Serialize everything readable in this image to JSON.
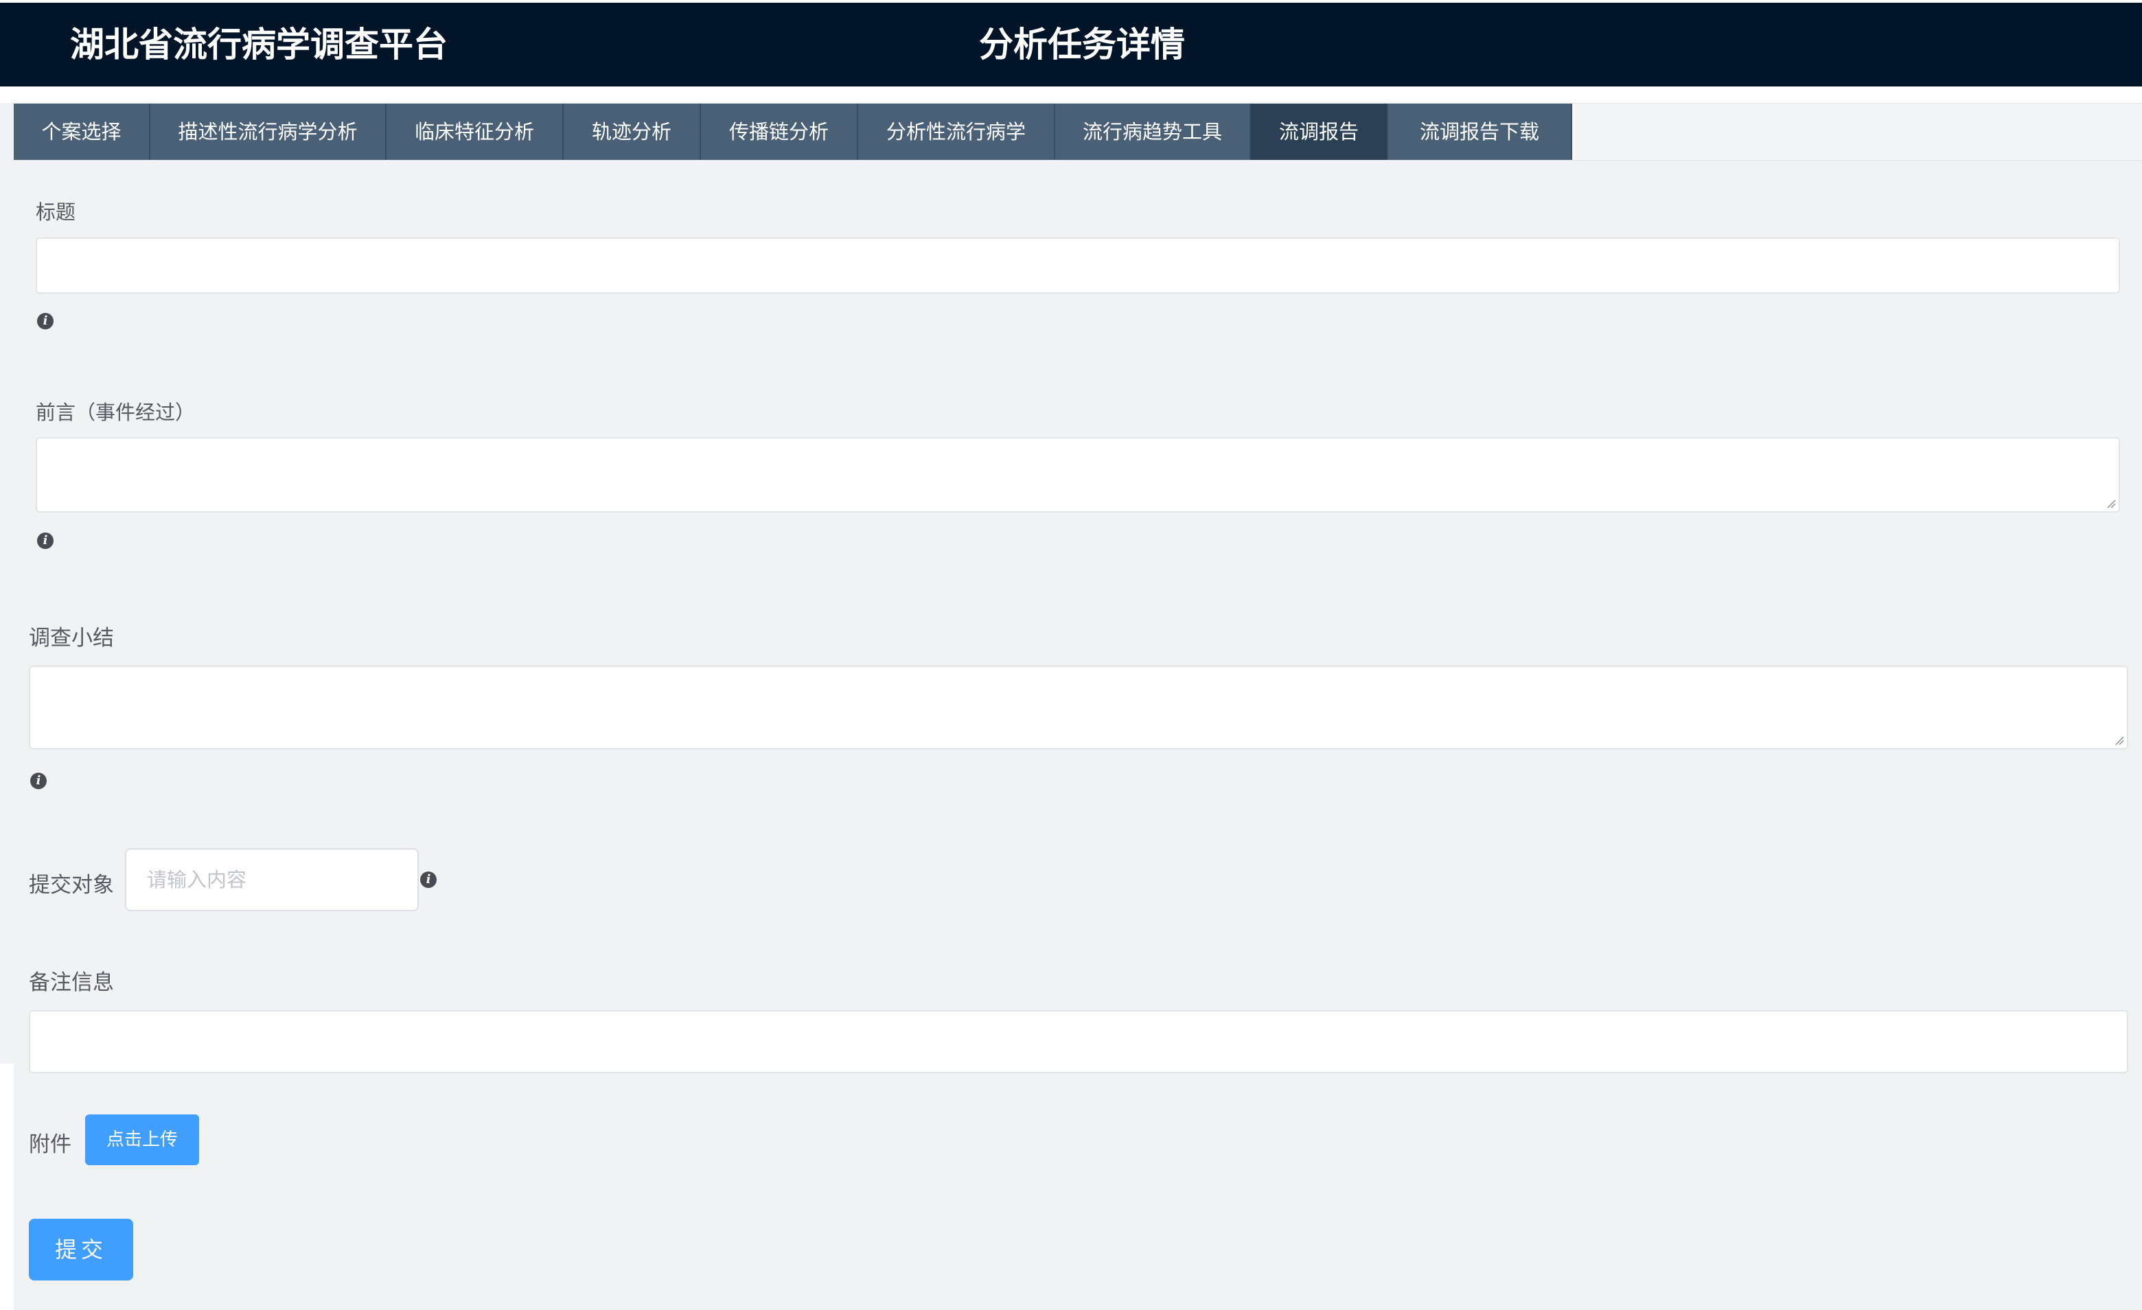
{
  "header": {
    "app_title": "湖北省流行病学调查平台",
    "page_title": "分析任务详情"
  },
  "tabs": [
    {
      "label": "个案选择",
      "active": false
    },
    {
      "label": "描述性流行病学分析",
      "active": false
    },
    {
      "label": "临床特征分析",
      "active": false
    },
    {
      "label": "轨迹分析",
      "active": false
    },
    {
      "label": "传播链分析",
      "active": false
    },
    {
      "label": "分析性流行病学",
      "active": false
    },
    {
      "label": "流行病趋势工具",
      "active": false
    },
    {
      "label": "流调报告",
      "active": true
    },
    {
      "label": "流调报告下载",
      "active": false
    }
  ],
  "form": {
    "title_label": "标题",
    "title_value": "",
    "preface_label": "前言（事件经过）",
    "preface_value": "",
    "summary_label": "调查小结",
    "summary_value": "",
    "target_label": "提交对象",
    "target_placeholder": "请输入内容",
    "remark_label": "备注信息",
    "remark_value": "",
    "attachment_label": "附件",
    "upload_button": "点击上传",
    "submit_button": "提交"
  },
  "icons": {
    "info": "info-icon"
  },
  "colors": {
    "header_bg": "#021428",
    "tab_bg": "#4a6077",
    "tab_active_bg": "#2b3f55",
    "primary_button": "#409eff",
    "page_bg": "#f1f2f4"
  }
}
